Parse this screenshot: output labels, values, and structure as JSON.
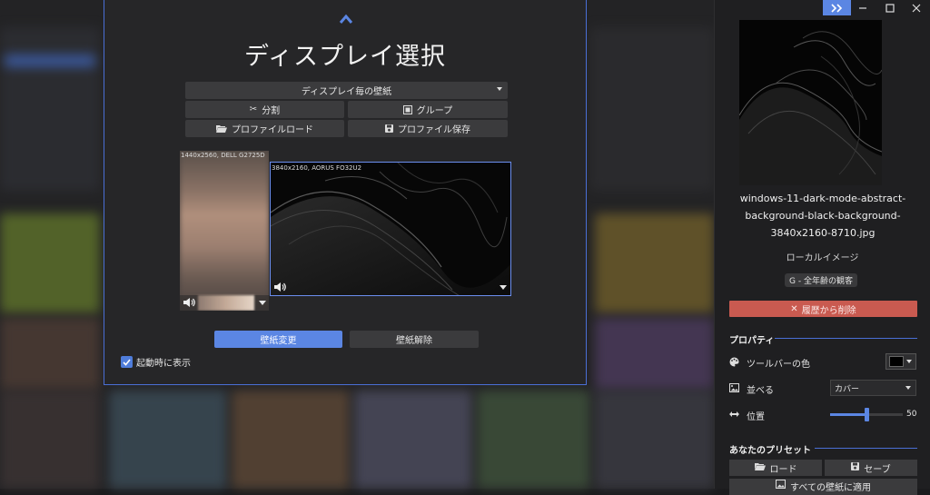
{
  "dialog": {
    "title": "ディスプレイ選択",
    "mode_select": "ディスプレイ毎の壁紙",
    "split_label": "分割",
    "group_label": "グループ",
    "profile_load_label": "プロファイルロード",
    "profile_save_label": "プロファイル保存",
    "monitors": [
      {
        "label": "1440x2560, DELL G2725D"
      },
      {
        "label": "3840x2160, AORUS FO32U2"
      }
    ],
    "change_wallpaper_label": "壁紙変更",
    "unset_wallpaper_label": "壁紙解除",
    "show_on_startup_label": "起動時に表示",
    "show_on_startup_checked": true
  },
  "sidebar": {
    "filename": "windows-11-dark-mode-abstract-background-black-background-3840x2160-8710.jpg",
    "filename_lines": [
      "windows-11-dark-mode-abstract-",
      "background-black-background-",
      "3840x2160-8710.jpg"
    ],
    "source": "ローカルイメージ",
    "rating": "G - 全年齢の観客",
    "remove_label": "履歴から削除",
    "properties_header": "プロパティ",
    "toolbar_color_label": "ツールバーの色",
    "toolbar_color": "#000000",
    "arrange_label": "並べる",
    "arrange_value": "カバー",
    "position_label": "位置",
    "position_value": "50",
    "presets_header": "あなたのプリセット",
    "load_label": "ロード",
    "save_label": "セーブ",
    "apply_all_label": "すべての壁紙に適用"
  },
  "colors": {
    "accent": "#5b86e3",
    "danger": "#c95a50",
    "dialog_border": "#4a6fd6"
  }
}
